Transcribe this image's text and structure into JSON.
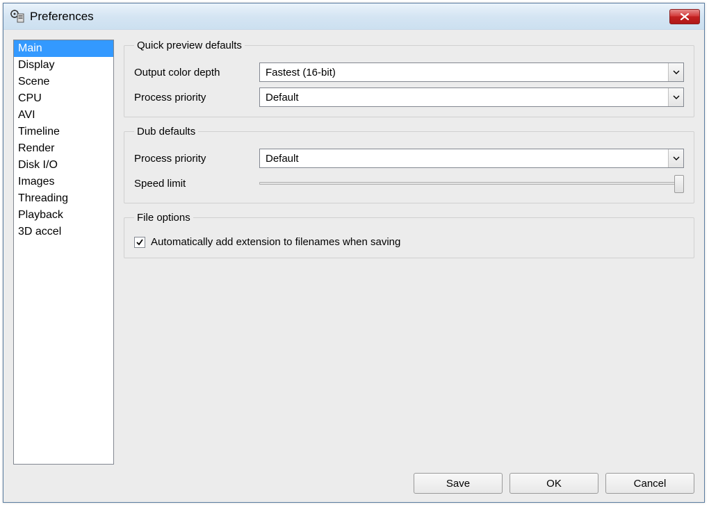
{
  "window": {
    "title": "Preferences"
  },
  "sidebar": {
    "items": [
      "Main",
      "Display",
      "Scene",
      "CPU",
      "AVI",
      "Timeline",
      "Render",
      "Disk I/O",
      "Images",
      "Threading",
      "Playback",
      "3D accel"
    ],
    "selected_index": 0
  },
  "groups": {
    "quick_preview": {
      "legend": "Quick preview defaults",
      "output_color_depth": {
        "label": "Output color depth",
        "value": "Fastest (16-bit)"
      },
      "process_priority": {
        "label": "Process priority",
        "value": "Default"
      }
    },
    "dub": {
      "legend": "Dub defaults",
      "process_priority": {
        "label": "Process priority",
        "value": "Default"
      },
      "speed_limit": {
        "label": "Speed limit"
      }
    },
    "file_options": {
      "legend": "File options",
      "auto_extension": {
        "label": "Automatically add extension to filenames when saving",
        "checked": true
      }
    }
  },
  "buttons": {
    "save": "Save",
    "ok": "OK",
    "cancel": "Cancel"
  }
}
